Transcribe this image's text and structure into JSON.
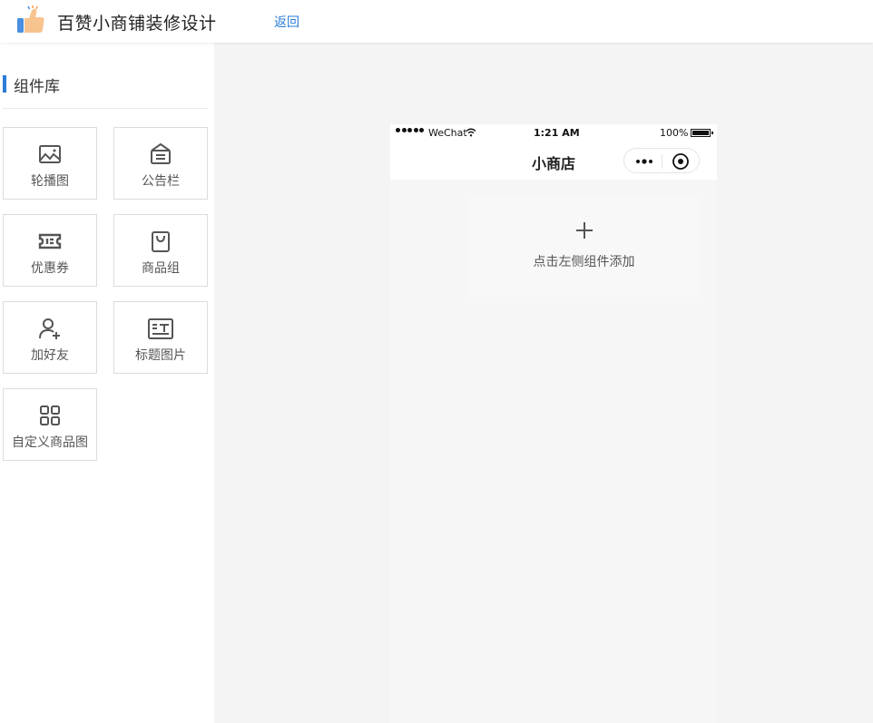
{
  "header": {
    "title": "百赞小商铺装修设计",
    "back_label": "返回",
    "logo_icon": "thumbs-up-icon"
  },
  "sidebar": {
    "title": "组件库",
    "accent_color": "#2a7cd6",
    "components": [
      {
        "label": "轮播图",
        "icon": "image-icon"
      },
      {
        "label": "公告栏",
        "icon": "notice-board-icon"
      },
      {
        "label": "优惠券",
        "icon": "ticket-icon"
      },
      {
        "label": "商品组",
        "icon": "shopping-bag-icon"
      },
      {
        "label": "加好友",
        "icon": "add-user-icon"
      },
      {
        "label": "标题图片",
        "icon": "title-image-icon"
      },
      {
        "label": "自定义商品图",
        "icon": "grid-icon"
      }
    ]
  },
  "phone": {
    "status": {
      "carrier": "WeChat",
      "time": "1:21 AM",
      "battery": "100%"
    },
    "nav_title": "小商店",
    "placeholder_text": "点击左侧组件添加"
  }
}
